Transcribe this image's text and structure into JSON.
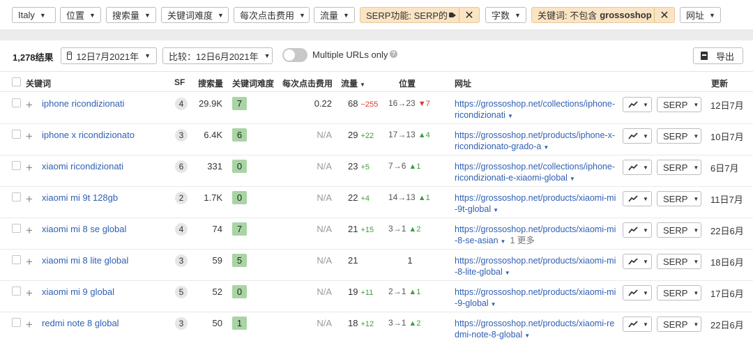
{
  "filters": {
    "country": "Italy",
    "position": "位置",
    "volume": "搜索量",
    "kd": "关键词难度",
    "cpc": "每次点击费用",
    "traffic": "流量",
    "serp_feature": "SERP功能: SERP的",
    "word_count": "字数",
    "keyword_exclude_prefix": "关键词: 不包含",
    "keyword_exclude_value": "grossoshop",
    "url": "网址"
  },
  "toolbar": {
    "results": "1,278结果",
    "date": "12日7月2021年",
    "compare": "比较：12日6月2021年",
    "multiple_urls": "Multiple URLs only",
    "help": "?",
    "export": "导出"
  },
  "columns": {
    "keyword": "关键词",
    "sf": "SF",
    "volume": "搜索量",
    "kd": "关键词难度",
    "cpc": "每次点击费用",
    "traffic": "流量",
    "position": "位置",
    "url": "网址",
    "updated": "更新"
  },
  "colors": {
    "kd_green": "#a8d5a3",
    "kd_green_dark": "#8fcb87",
    "positive": "#3f9d3f",
    "negative": "#d63b2a",
    "link": "#2f5fb3",
    "active_filter": "#fbe4c3"
  },
  "rows": [
    {
      "keyword": "iphone ricondizionati",
      "sf": "4",
      "volume": "29.9K",
      "kd": "7",
      "cpc": "0.22",
      "traffic": "68",
      "traffic_change": "−255",
      "traffic_dir": "down",
      "pos_from": "16",
      "pos_to": "23",
      "pos_change": "7",
      "pos_dir": "down",
      "url_line1": "https://grossoshop.net/collections/iphon",
      "url_line2": "e-ricondizionati",
      "more": "",
      "updated": "12日7月"
    },
    {
      "keyword": "iphone x ricondizionato",
      "sf": "3",
      "volume": "6.4K",
      "kd": "6",
      "cpc": "N/A",
      "traffic": "29",
      "traffic_change": "+22",
      "traffic_dir": "up",
      "pos_from": "17",
      "pos_to": "13",
      "pos_change": "4",
      "pos_dir": "up",
      "url_line1": "https://grossoshop.net/products/iphone",
      "url_line2": "-x-ricondizionato-grado-a",
      "more": "",
      "updated": "10日7月"
    },
    {
      "keyword": "xiaomi ricondizionati",
      "sf": "6",
      "volume": "331",
      "kd": "0",
      "cpc": "N/A",
      "traffic": "23",
      "traffic_change": "+5",
      "traffic_dir": "up",
      "pos_from": "7",
      "pos_to": "6",
      "pos_change": "1",
      "pos_dir": "up",
      "url_line1": "https://grossoshop.net/collections/iphon",
      "url_line2": "e-ricondizionati-e-xiaomi-global",
      "more": "",
      "updated": "6日7月"
    },
    {
      "keyword": "xiaomi mi 9t 128gb",
      "sf": "2",
      "volume": "1.7K",
      "kd": "0",
      "cpc": "N/A",
      "traffic": "22",
      "traffic_change": "+4",
      "traffic_dir": "up",
      "pos_from": "14",
      "pos_to": "13",
      "pos_change": "1",
      "pos_dir": "up",
      "url_line1": "https://grossoshop.net/products/xiaomi-",
      "url_line2": "mi-9t-global",
      "more": "",
      "updated": "11日7月"
    },
    {
      "keyword": "xiaomi mi 8 se global",
      "sf": "4",
      "volume": "74",
      "kd": "7",
      "cpc": "N/A",
      "traffic": "21",
      "traffic_change": "+15",
      "traffic_dir": "up",
      "pos_from": "3",
      "pos_to": "1",
      "pos_change": "2",
      "pos_dir": "up",
      "url_line1": "https://grossoshop.net/products/xiaomi-",
      "url_line2": "mi-8-se-asian",
      "more": "1 更多",
      "updated": "22日6月"
    },
    {
      "keyword": "xiaomi mi 8 lite global",
      "sf": "3",
      "volume": "59",
      "kd": "5",
      "cpc": "N/A",
      "traffic": "21",
      "traffic_change": "",
      "traffic_dir": "none",
      "pos_from": "",
      "pos_to": "1",
      "pos_change": "",
      "pos_dir": "none",
      "url_line1": "https://grossoshop.net/products/xiaomi-",
      "url_line2": "mi-8-lite-global",
      "more": "",
      "updated": "18日6月"
    },
    {
      "keyword": "xiaomi mi 9 global",
      "sf": "5",
      "volume": "52",
      "kd": "0",
      "cpc": "N/A",
      "traffic": "19",
      "traffic_change": "+11",
      "traffic_dir": "up",
      "pos_from": "2",
      "pos_to": "1",
      "pos_change": "1",
      "pos_dir": "up",
      "url_line1": "https://grossoshop.net/products/xiaomi-",
      "url_line2": "mi-9-global",
      "more": "",
      "updated": "17日6月"
    },
    {
      "keyword": "redmi note 8 global",
      "sf": "3",
      "volume": "50",
      "kd": "1",
      "cpc": "N/A",
      "traffic": "18",
      "traffic_change": "+12",
      "traffic_dir": "up",
      "pos_from": "3",
      "pos_to": "1",
      "pos_change": "2",
      "pos_dir": "up",
      "url_line1": "https://grossoshop.net/products/xiaomi-",
      "url_line2": "redmi-note-8-global",
      "more": "",
      "updated": "22日6月"
    }
  ],
  "row_actions": {
    "serp": "SERP"
  }
}
